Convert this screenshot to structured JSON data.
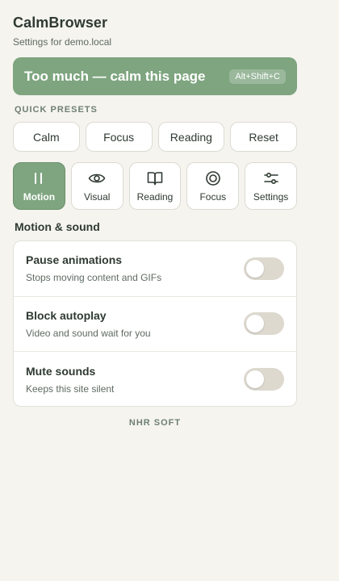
{
  "app": {
    "title": "CalmBrowser",
    "subtitle": "Settings for demo.local"
  },
  "calm_banner": {
    "label": "Too much — calm this page",
    "shortcut": "Alt+Shift+C"
  },
  "presets": {
    "section_label": "QUICK PRESETS",
    "items": [
      {
        "label": "Calm"
      },
      {
        "label": "Focus"
      },
      {
        "label": "Reading"
      },
      {
        "label": "Reset"
      }
    ]
  },
  "tabs": [
    {
      "label": "Motion",
      "icon": "pause-icon",
      "active": true
    },
    {
      "label": "Visual",
      "icon": "eye-icon",
      "active": false
    },
    {
      "label": "Reading",
      "icon": "book-icon",
      "active": false
    },
    {
      "label": "Focus",
      "icon": "target-icon",
      "active": false
    },
    {
      "label": "Settings",
      "icon": "sliders-icon",
      "active": false
    }
  ],
  "motion_sound": {
    "title": "Motion & sound",
    "settings": [
      {
        "title": "Pause animations",
        "description": "Stops moving content and GIFs",
        "enabled": false
      },
      {
        "title": "Block autoplay",
        "description": "Video and sound wait for you",
        "enabled": false
      },
      {
        "title": "Mute sounds",
        "description": "Keeps this site silent",
        "enabled": false
      }
    ]
  },
  "footer": {
    "brand": "NHR SOFT"
  },
  "colors": {
    "accent": "#7ea57f",
    "background": "#f5f4ef",
    "toggle_off": "#ddd9cf",
    "text": "#2f3a32"
  }
}
